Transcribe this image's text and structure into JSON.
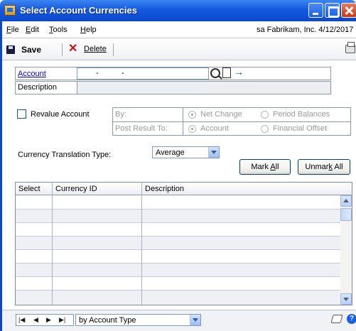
{
  "window": {
    "title": "Select Account Currencies"
  },
  "menu": {
    "items": [
      {
        "first": "F",
        "rest": "ile"
      },
      {
        "first": "E",
        "rest": "dit"
      },
      {
        "first": "T",
        "rest": "ools"
      },
      {
        "first": "H",
        "rest": "elp"
      }
    ],
    "company_info": "sa  Fabrikam, Inc.  4/12/2017"
  },
  "toolbar": {
    "save_label": "Save",
    "delete_first": "D",
    "delete_rest": "elete"
  },
  "form": {
    "account_label": "Account",
    "account_segments": [
      "-",
      "-"
    ],
    "description_label": "Description",
    "description_value": "",
    "revalue_label": "Revalue Account",
    "revalue_checked": false,
    "by_label": "By:",
    "by_options": [
      "Net Change",
      "Period Balances"
    ],
    "by_selected": "Net Change",
    "post_label": "Post Result To:",
    "post_options": [
      "Account",
      "Financial Offset"
    ],
    "post_selected": "Account",
    "ctt_label": "Currency Translation Type:",
    "ctt_value": "Average"
  },
  "buttons": {
    "mark_all_pre": "Mark ",
    "mark_all_key": "A",
    "mark_all_post": "ll",
    "unmark_all_pre": "Unmar",
    "unmark_all_key": "k",
    "unmark_all_post": " All"
  },
  "grid": {
    "columns": [
      "Select",
      "Currency ID",
      "Description"
    ],
    "rows": []
  },
  "statusbar": {
    "nav_glyphs": [
      "|◀",
      "◀",
      "▶",
      "▶|"
    ],
    "sort_value": "by Account Type"
  }
}
